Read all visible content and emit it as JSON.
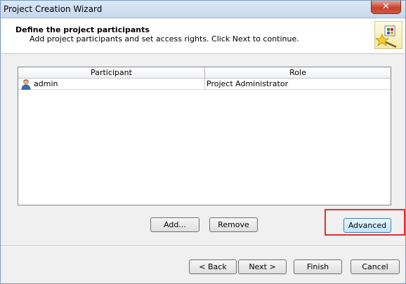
{
  "window": {
    "title": "Project Creation Wizard",
    "close_label": "✕"
  },
  "header": {
    "title": "Define the project participants",
    "subtitle": "Add project participants and set access rights.  Click Next to continue.",
    "icon": "wizard-wand-icon"
  },
  "participants_table": {
    "columns": [
      "Participant",
      "Role"
    ],
    "rows": [
      {
        "participant": "admin",
        "role": "Project Administrator",
        "icon": "user-icon"
      }
    ]
  },
  "actions": {
    "add_label": "Add...",
    "remove_label": "Remove",
    "advanced_label": "Advanced"
  },
  "nav": {
    "back_label": "< Back",
    "next_label": "Next >",
    "finish_label": "Finish",
    "cancel_label": "Cancel"
  },
  "colors": {
    "highlight": "#e03030",
    "title_bar": "#c7d9ee"
  }
}
